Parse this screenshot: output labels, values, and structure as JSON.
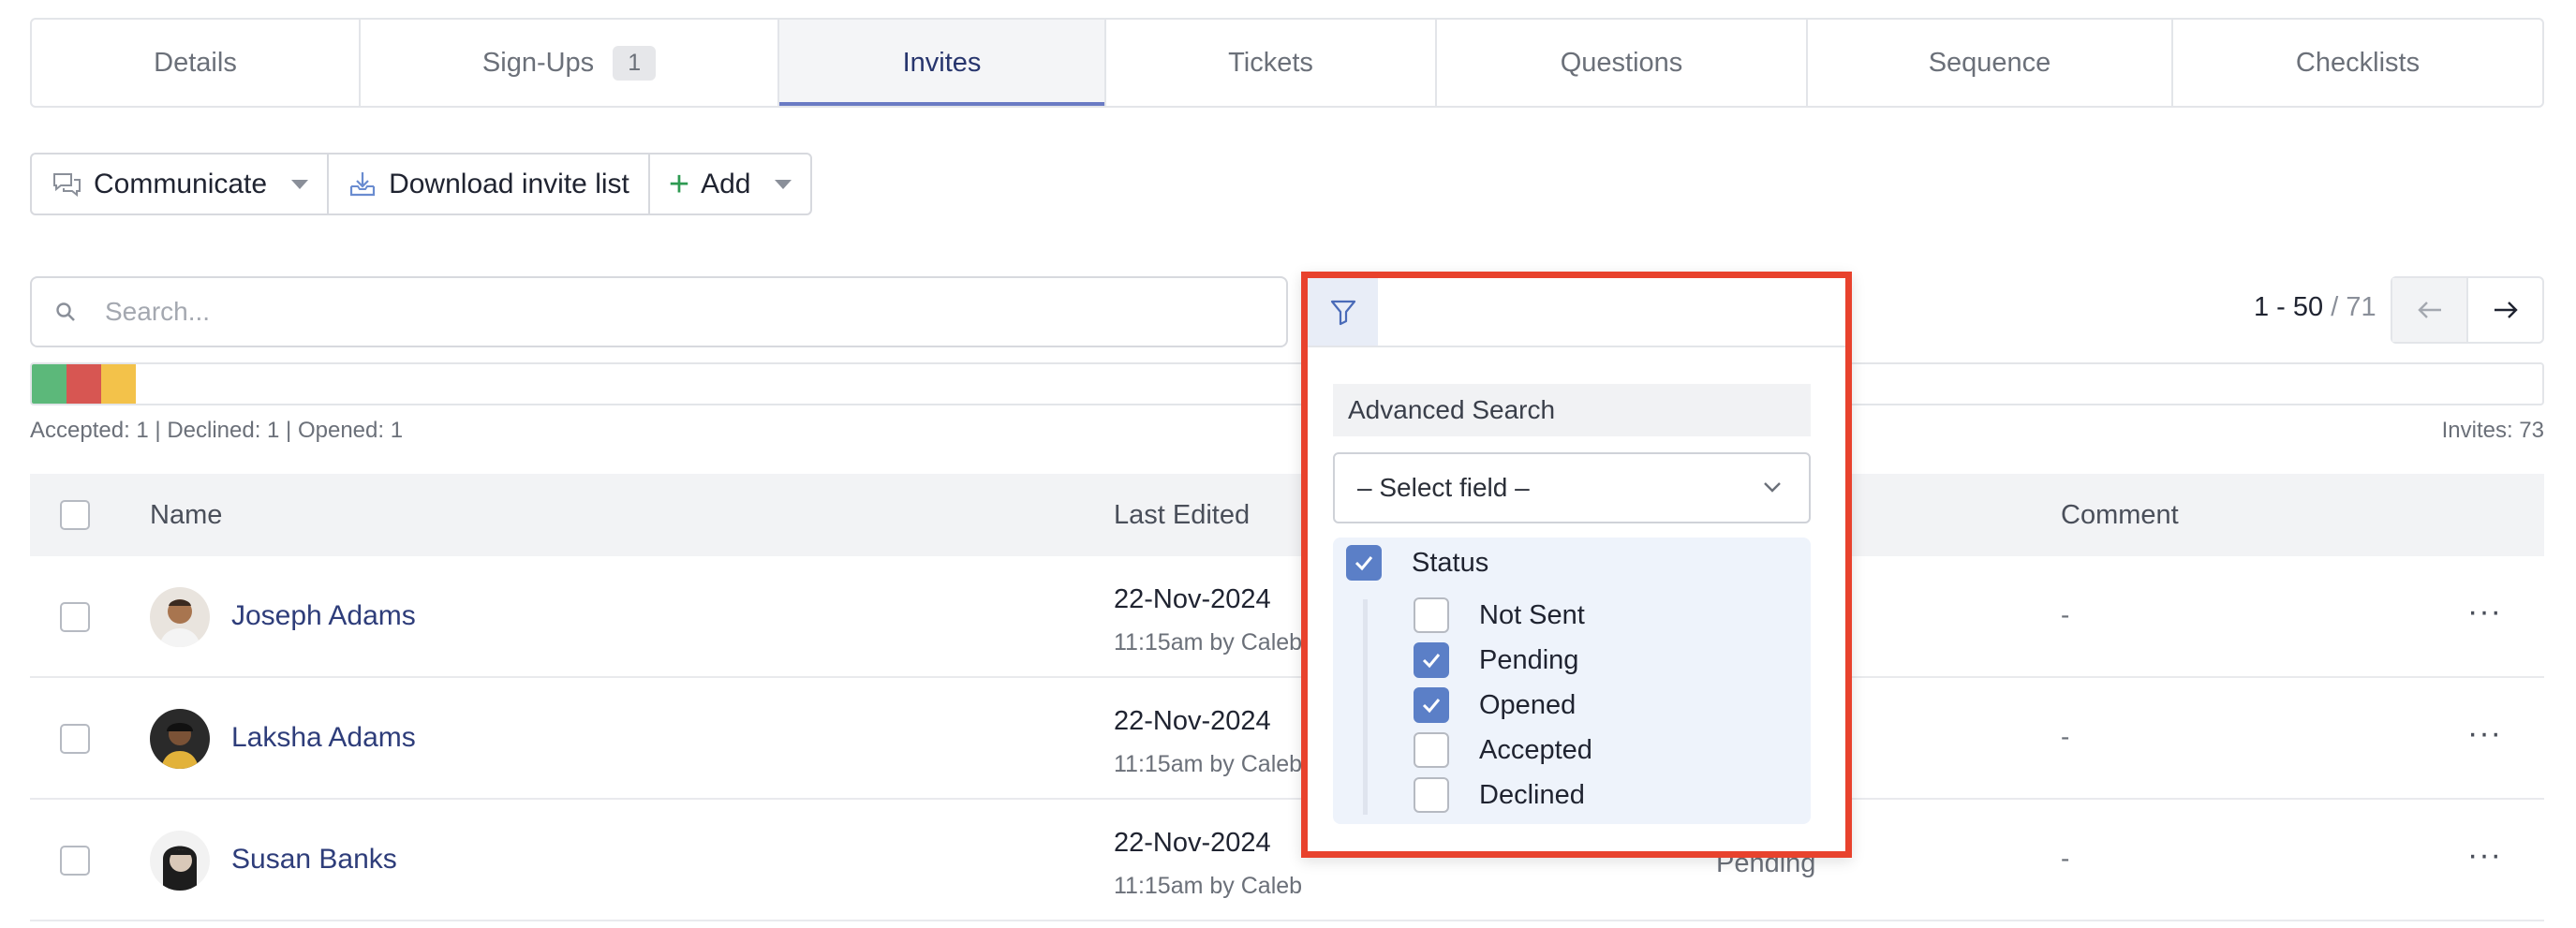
{
  "tabs": [
    {
      "label": "Details"
    },
    {
      "label": "Sign-Ups",
      "count": "1"
    },
    {
      "label": "Invites",
      "active": true
    },
    {
      "label": "Tickets"
    },
    {
      "label": "Questions"
    },
    {
      "label": "Sequence"
    },
    {
      "label": "Checklists"
    }
  ],
  "toolbar": {
    "communicate_label": "Communicate",
    "download_label": "Download invite list",
    "add_label": "Add"
  },
  "search": {
    "placeholder": "Search..."
  },
  "pagination": {
    "range": "1 - 50",
    "total": "/ 71"
  },
  "status_colors": {
    "accepted": "#5cb87a",
    "declined": "#d75652",
    "opened": "#f3c24a"
  },
  "summary": "Accepted: 1 | Declined: 1 | Opened: 1",
  "invites_count": "Invites: 73",
  "table": {
    "headers": {
      "name": "Name",
      "last_edited": "Last Edited",
      "comment": "Comment"
    },
    "rows": [
      {
        "name": "Joseph Adams",
        "date": "22-Nov-2024",
        "edited": "11:15am by Caleb",
        "status": "",
        "comment": "-"
      },
      {
        "name": "Laksha Adams",
        "date": "22-Nov-2024",
        "edited": "11:15am by Caleb",
        "status": "",
        "comment": "-"
      },
      {
        "name": "Susan Banks",
        "date": "22-Nov-2024",
        "edited": "11:15am by Caleb",
        "status": "Pending",
        "comment": "-"
      }
    ]
  },
  "filter": {
    "advanced_search_label": "Advanced Search",
    "select_placeholder": "– Select field –",
    "status_label": "Status",
    "options": [
      {
        "label": "Not Sent",
        "checked": false
      },
      {
        "label": "Pending",
        "checked": true
      },
      {
        "label": "Opened",
        "checked": true
      },
      {
        "label": "Accepted",
        "checked": false
      },
      {
        "label": "Declined",
        "checked": false
      }
    ]
  },
  "colors": {
    "accent": "#6a7bc4",
    "highlight_border": "#e8422d",
    "checkbox_checked": "#5b7fc7"
  }
}
